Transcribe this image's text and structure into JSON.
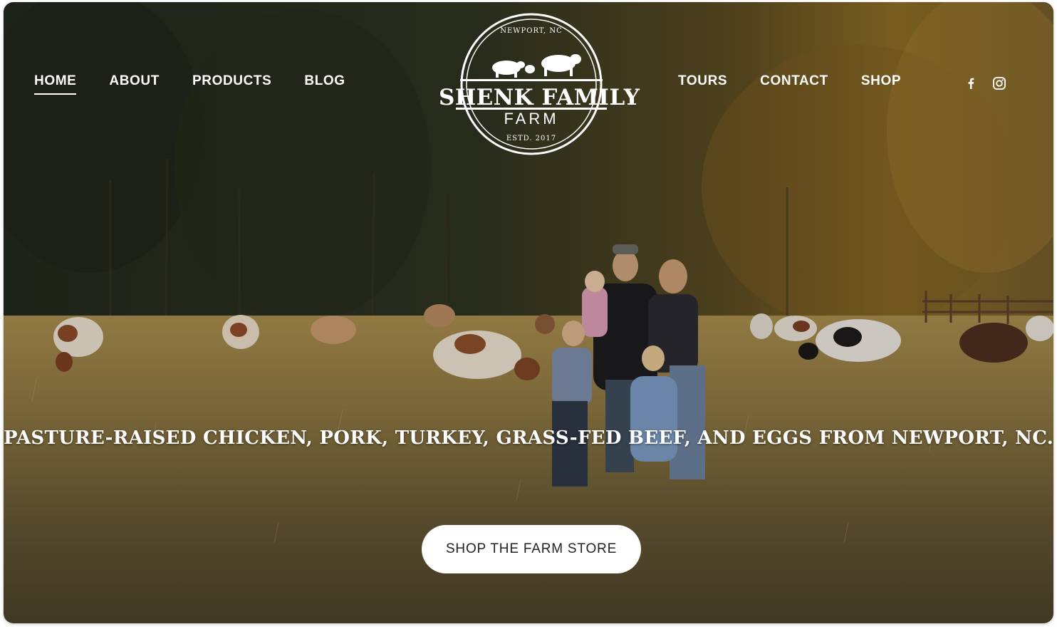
{
  "nav_left": {
    "items": [
      {
        "label": "HOME",
        "active": true
      },
      {
        "label": "ABOUT"
      },
      {
        "label": "PRODUCTS"
      },
      {
        "label": "BLOG"
      }
    ]
  },
  "nav_right": {
    "items": [
      {
        "label": "TOURS"
      },
      {
        "label": "CONTACT"
      },
      {
        "label": "SHOP"
      }
    ]
  },
  "social": {
    "icons": [
      "facebook-icon",
      "instagram-icon"
    ]
  },
  "logo": {
    "top_text": "NEWPORT, NC",
    "title": "SHENK FAMILY",
    "subtitle": "FARM",
    "bottom_text": "ESTD. 2017"
  },
  "hero": {
    "tagline": "PASTURE-RAISED CHICKEN, PORK, TURKEY, GRASS-FED BEEF, AND EGGS FROM NEWPORT, NC.",
    "cta_label": "SHOP THE FARM STORE"
  },
  "colors": {
    "text": "#ffffff",
    "button_bg": "#ffffff",
    "button_text": "#222222"
  }
}
